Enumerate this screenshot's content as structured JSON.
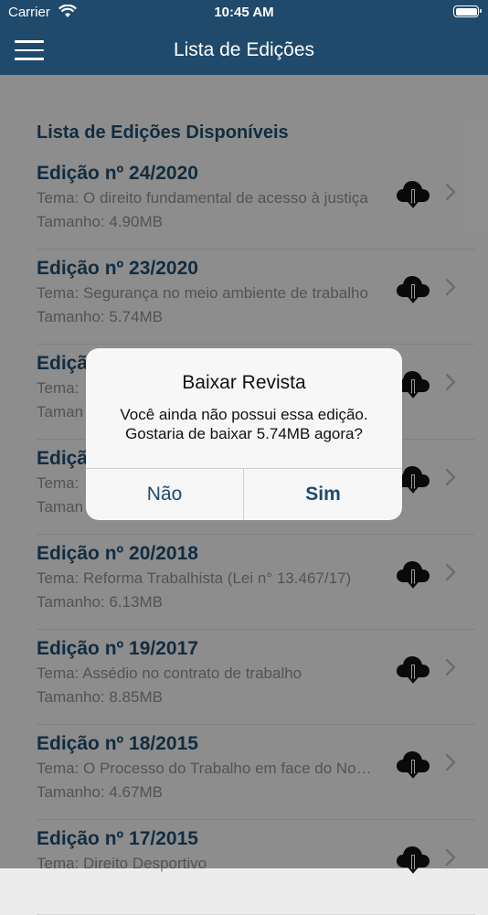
{
  "status": {
    "carrier": "Carrier",
    "time": "10:45 AM"
  },
  "nav": {
    "title": "Lista de Edições"
  },
  "section": {
    "title": "Lista de Edições Disponíveis"
  },
  "editions": [
    {
      "title": "Edição nº 24/2020",
      "tema": "Tema: O direito fundamental de acesso à justiça",
      "size": "Tamanho: 4.90MB"
    },
    {
      "title": "Edição nº 23/2020",
      "tema": "Tema: Segurança no meio ambiente de trabalho",
      "size": "Tamanho: 5.74MB"
    },
    {
      "title": "Edição",
      "tema": "Tema:",
      "size": "Taman"
    },
    {
      "title": "Ediçã",
      "tema": "Tema:",
      "size": "Taman"
    },
    {
      "title": "Edição nº 20/2018",
      "tema": "Tema: Reforma Trabalhista (Lei n° 13.467/17)",
      "size": "Tamanho: 6.13MB"
    },
    {
      "title": "Edição nº 19/2017",
      "tema": "Tema: Assédio no contrato de trabalho",
      "size": "Tamanho: 8.85MB"
    },
    {
      "title": "Edição nº 18/2015",
      "tema": "Tema: O Processo do Trabalho em face do Novo CPC",
      "size": "Tamanho: 4.67MB"
    },
    {
      "title": "Edição nº 17/2015",
      "tema": "Tema: Direito Desportivo",
      "size": ""
    }
  ],
  "dialog": {
    "title": "Baixar Revista",
    "message_line1": "Você ainda não possui essa edição.",
    "message_line2": "Gostaria de baixar 5.74MB agora?",
    "no_label": "Não",
    "yes_label": "Sim"
  },
  "colors": {
    "primary": "#1f4a6b",
    "secondary_text": "#8a8a8a",
    "background": "#ececec"
  }
}
